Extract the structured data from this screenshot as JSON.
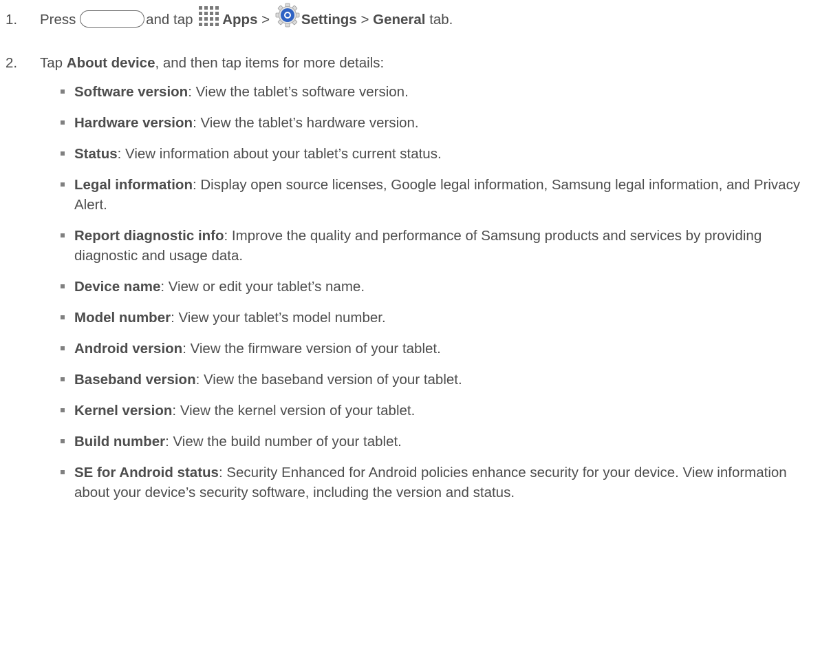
{
  "steps": [
    {
      "number": "1.",
      "press_text": "Press",
      "and_tap_text": "and tap",
      "apps_label": "Apps",
      "sep1": ">",
      "settings_label": "Settings",
      "sep2": ">",
      "general_label": "General",
      "tab_text": "tab."
    },
    {
      "number": "2.",
      "tap_text": "Tap",
      "about_label": "About device",
      "rest_text": ", and then tap items for more details:"
    }
  ],
  "items": [
    {
      "term": "Software version",
      "desc": ": View the tablet’s software version."
    },
    {
      "term": "Hardware version",
      "desc": ": View the tablet’s hardware version."
    },
    {
      "term": "Status",
      "desc": ": View information about your tablet’s current status."
    },
    {
      "term": "Legal information",
      "desc": ": Display open source licenses, Google legal information, Samsung legal information, and Privacy Alert."
    },
    {
      "term": "Report diagnostic info",
      "desc": ": Improve the quality and performance of Samsung products and services by providing diagnostic and usage data."
    },
    {
      "term": "Device name",
      "desc": ": View or edit your tablet’s name."
    },
    {
      "term": "Model number",
      "desc": ": View your tablet’s model number."
    },
    {
      "term": "Android version",
      "desc": ": View the firmware version of your tablet."
    },
    {
      "term": "Baseband version",
      "desc": ": View the baseband version of your tablet."
    },
    {
      "term": "Kernel version",
      "desc": ": View the kernel version of your tablet."
    },
    {
      "term": "Build number",
      "desc": ": View the build number of your tablet."
    },
    {
      "term": "SE for Android status",
      "desc": ":  Security Enhanced for Android policies enhance security for your device. View information about your device’s security software, including the version and status."
    }
  ],
  "icons": {
    "home_key": "home-key-icon",
    "apps": "apps-grid-icon",
    "settings": "settings-gear-icon"
  },
  "colors": {
    "text": "#4d4d4d",
    "bullet": "#808080",
    "settings_blue": "#2f63c4"
  }
}
